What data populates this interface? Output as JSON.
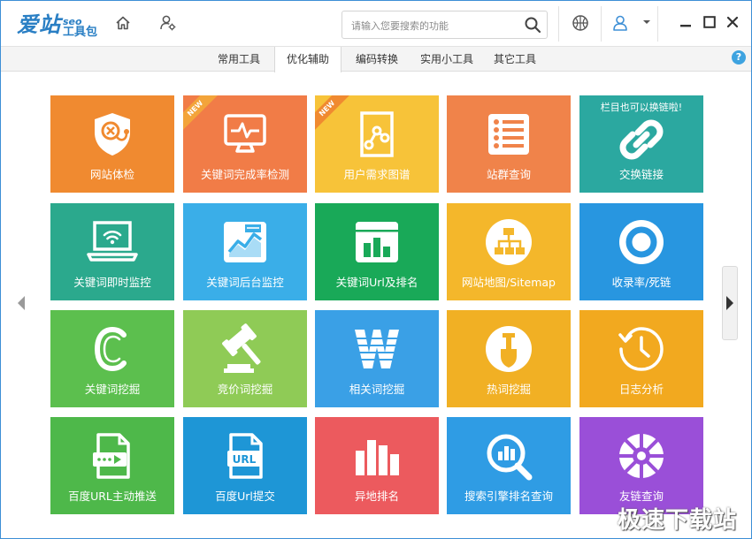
{
  "app": {
    "logo_main": "爱站",
    "logo_seo": "seo",
    "logo_sub": "工具包"
  },
  "search": {
    "placeholder": "请输入您要搜索的功能",
    "value": ""
  },
  "tabs": [
    {
      "label": "常用工具",
      "active": false
    },
    {
      "label": "优化辅助",
      "active": true
    },
    {
      "label": "编码转换",
      "active": false
    },
    {
      "label": "实用小工具",
      "active": false
    },
    {
      "label": "其它工具",
      "active": false
    }
  ],
  "help_label": "?",
  "tiles": [
    {
      "label": "网站体检",
      "color": "#f08a30",
      "icon": "shield-stethoscope-icon"
    },
    {
      "label": "关键词完成率检测",
      "color": "#f17c47",
      "icon": "monitor-pulse-icon",
      "badge": "NEW"
    },
    {
      "label": "用户需求图谱",
      "color": "#f7c339",
      "icon": "graph-doc-icon",
      "badge": "NEW"
    },
    {
      "label": "站群查询",
      "color": "#f0834a",
      "icon": "list-icon"
    },
    {
      "label": "交换链接",
      "color": "#2ba8a0",
      "icon": "chain-link-icon",
      "note": "栏目也可以换链啦!"
    },
    {
      "label": "关键词即时监控",
      "color": "#2ba98d",
      "icon": "laptop-wifi-icon"
    },
    {
      "label": "关键词后台监控",
      "color": "#3aaee8",
      "icon": "chart-window-icon"
    },
    {
      "label": "关键词Url及排名",
      "color": "#19a958",
      "icon": "bar-chart-window-icon"
    },
    {
      "label": "网站地图/Sitemap",
      "color": "#f4b72b",
      "icon": "sitemap-icon"
    },
    {
      "label": "收录率/死链",
      "color": "#2896e0",
      "icon": "ring-icon"
    },
    {
      "label": "关键词挖掘",
      "color": "#5cbf4e",
      "icon": "letter-c-icon"
    },
    {
      "label": "竞价词挖掘",
      "color": "#8fcb56",
      "icon": "gavel-icon"
    },
    {
      "label": "相关词挖掘",
      "color": "#3aa0e6",
      "icon": "letter-w-icon"
    },
    {
      "label": "热词挖掘",
      "color": "#f1b024",
      "icon": "shovel-icon"
    },
    {
      "label": "日志分析",
      "color": "#f2a91f",
      "icon": "clock-icon"
    },
    {
      "label": "百度URL主动推送",
      "color": "#4eb84a",
      "icon": "url-push-icon"
    },
    {
      "label": "百度Url提交",
      "color": "#1e96d6",
      "icon": "url-file-icon"
    },
    {
      "label": "异地排名",
      "color": "#ec5a5e",
      "icon": "bars-icon"
    },
    {
      "label": "搜索引擎排名查询",
      "color": "#2f9ce4",
      "icon": "search-chart-icon"
    },
    {
      "label": "友链查询",
      "color": "#9a4fd8",
      "icon": "wheel-icon"
    }
  ],
  "watermark": "极速下载站"
}
